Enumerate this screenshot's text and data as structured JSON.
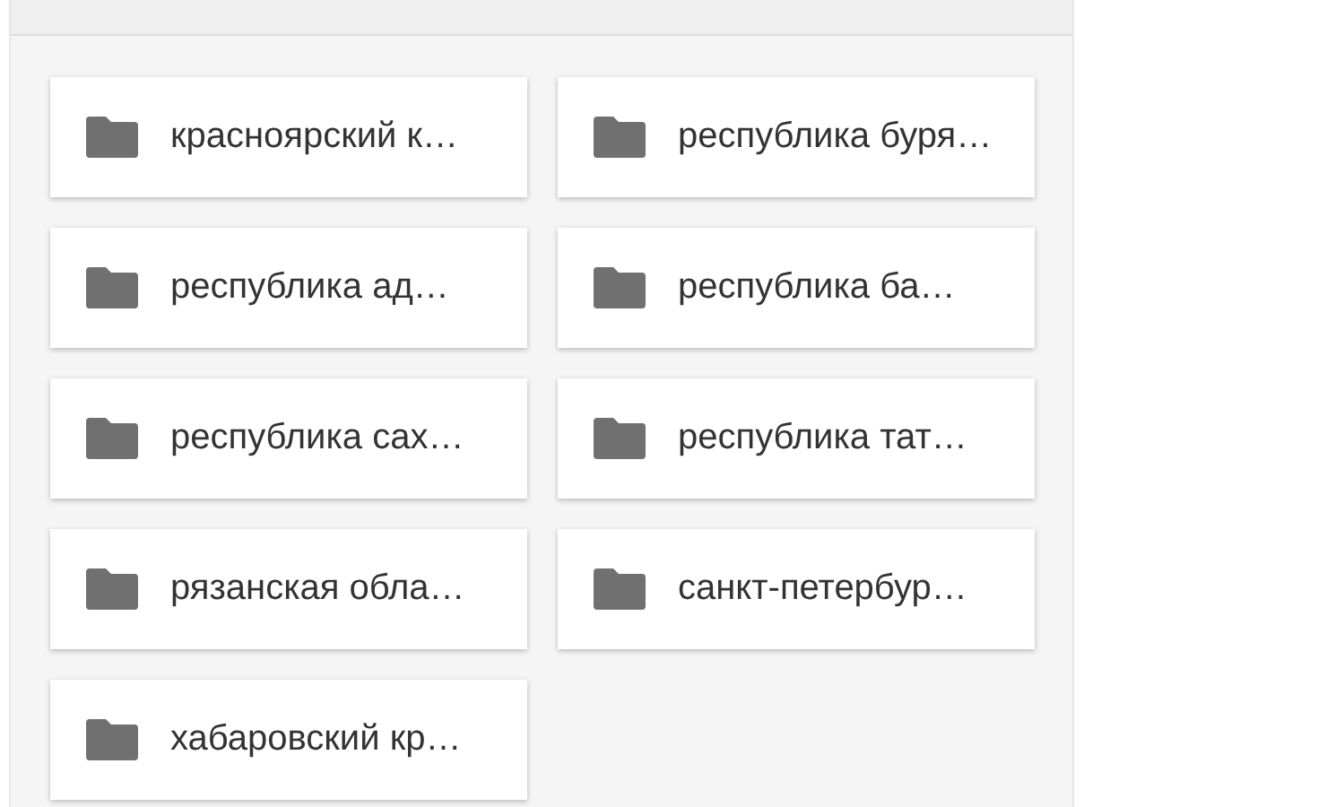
{
  "folders": [
    {
      "name": "красноярский к…"
    },
    {
      "name": "республика буря…"
    },
    {
      "name": "республика ад…"
    },
    {
      "name": "республика ба…"
    },
    {
      "name": "республика сах…"
    },
    {
      "name": "республика тат…"
    },
    {
      "name": "рязанская обла…"
    },
    {
      "name": "санкт-петербур…"
    },
    {
      "name": "хабаровский кр…"
    }
  ]
}
